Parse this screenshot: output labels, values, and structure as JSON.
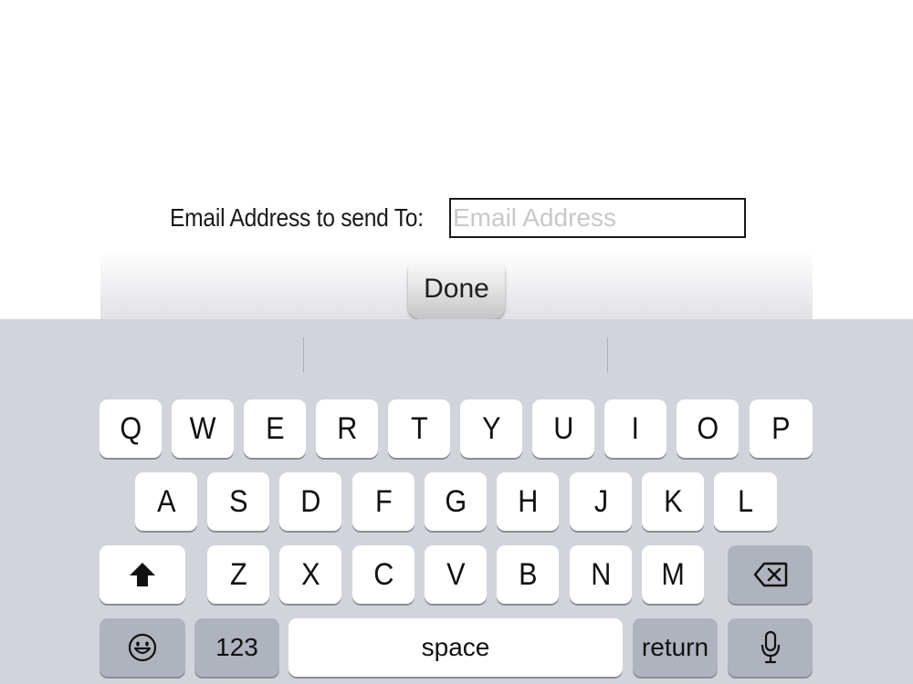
{
  "form": {
    "label": "Email Address to send To:",
    "email_value": "",
    "email_placeholder": "Email Address",
    "done_label": "Done"
  },
  "keyboard": {
    "row1": [
      "Q",
      "W",
      "E",
      "R",
      "T",
      "Y",
      "U",
      "I",
      "O",
      "P"
    ],
    "row2": [
      "A",
      "S",
      "D",
      "F",
      "G",
      "H",
      "J",
      "K",
      "L"
    ],
    "row3": [
      "Z",
      "X",
      "C",
      "V",
      "B",
      "N",
      "M"
    ],
    "numbers_label": "123",
    "space_label": "space",
    "return_label": "return",
    "icons": {
      "shift": "shift-icon",
      "delete": "delete-icon",
      "emoji": "emoji-icon",
      "dictation": "microphone-icon"
    },
    "colors": {
      "keyboard_background": "#d1d4db",
      "letter_key": "#ffffff",
      "function_key": "#aeb3bd"
    }
  }
}
